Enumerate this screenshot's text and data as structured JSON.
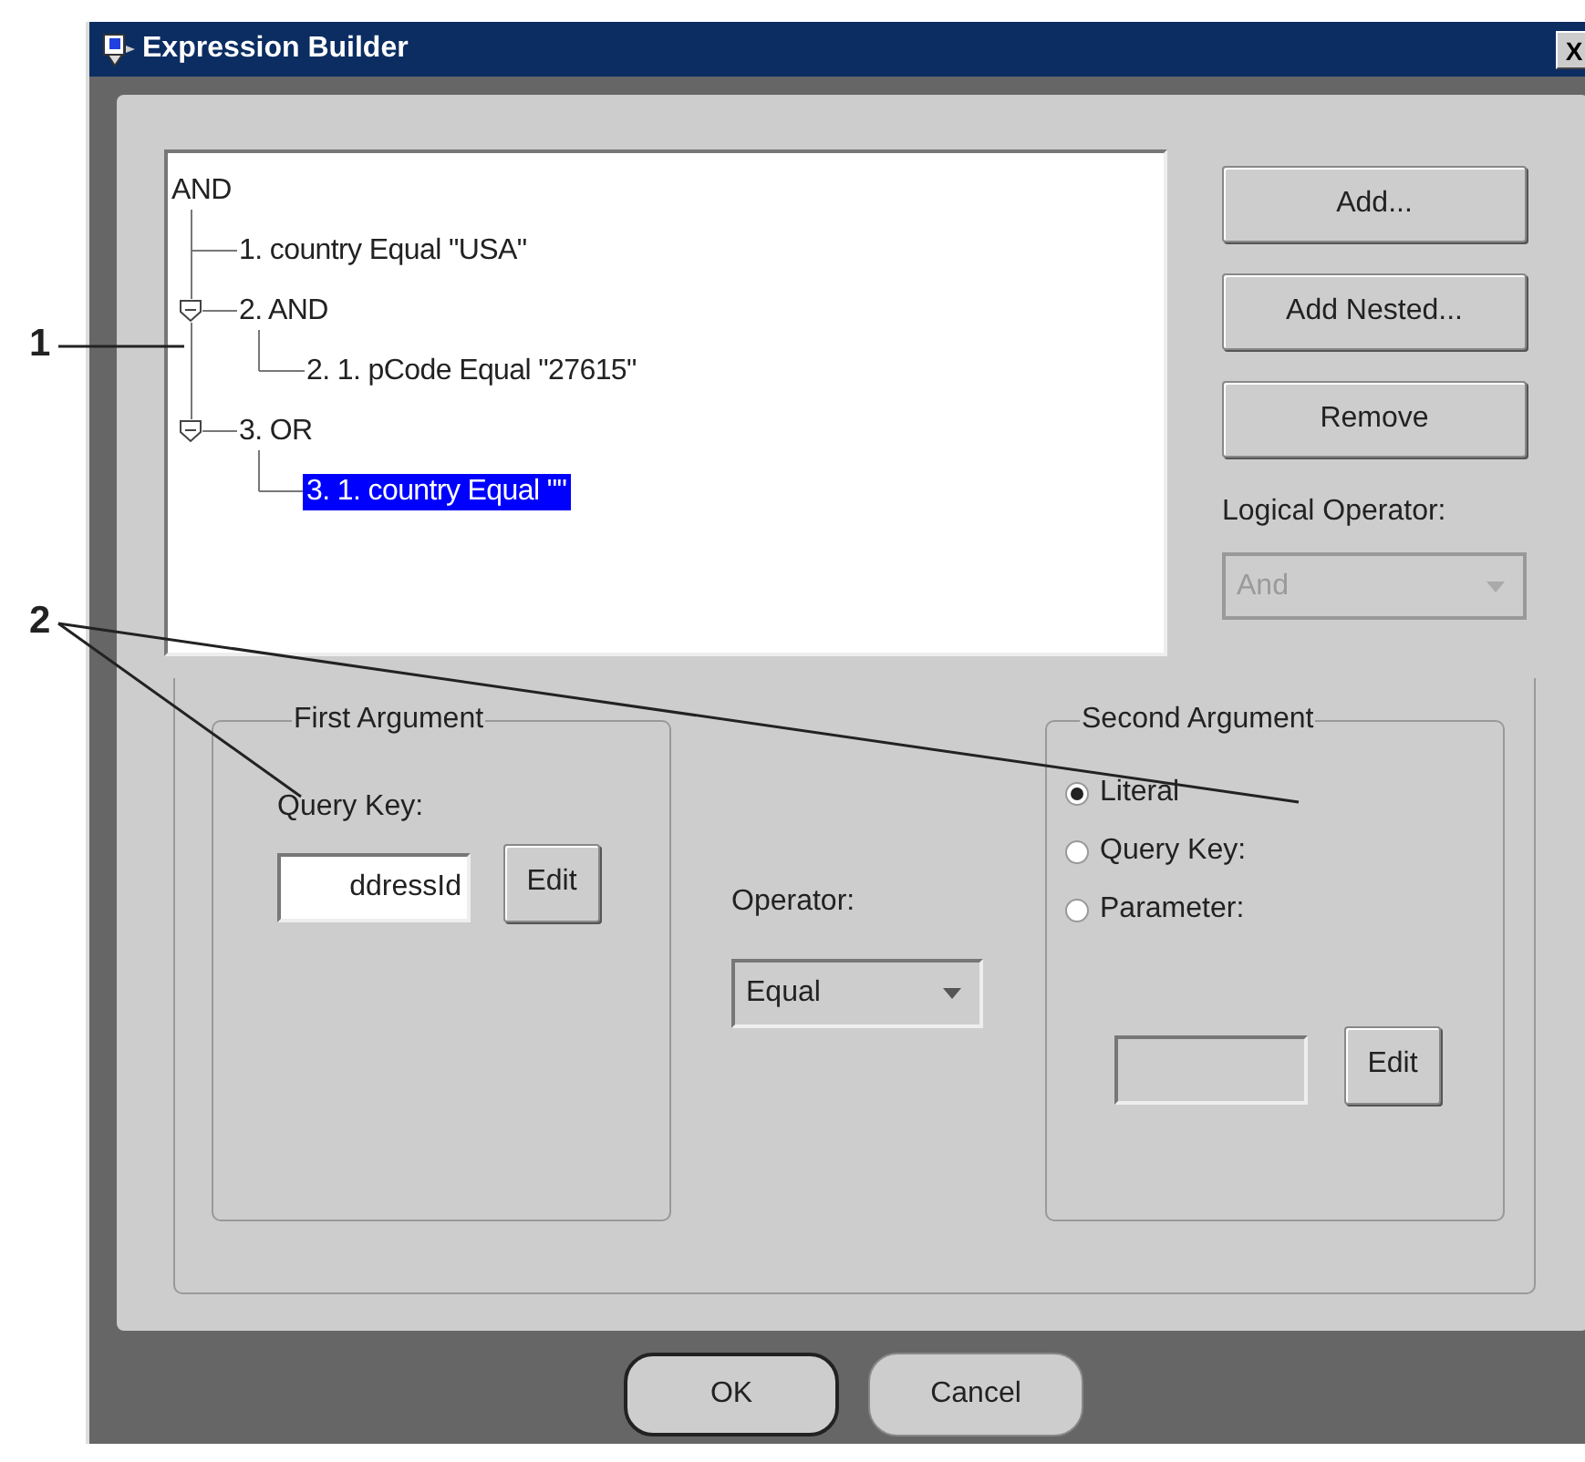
{
  "window": {
    "title": "Expression Builder",
    "close": "X"
  },
  "tree": {
    "label": "AND",
    "selected": false,
    "children": [
      {
        "label": "1. country Equal \"USA\"",
        "selected": false
      },
      {
        "label": "2. AND",
        "selected": false,
        "expanded": true,
        "children": [
          {
            "label": "2. 1. pCode Equal \"27615\"",
            "selected": false
          }
        ]
      },
      {
        "label": "3. OR",
        "selected": false,
        "expanded": true,
        "children": [
          {
            "label": "3. 1. country Equal \"\"",
            "selected": true
          }
        ]
      }
    ]
  },
  "buttons": [
    "Add...",
    "Add Nested...",
    "Remove"
  ],
  "logical_operator": {
    "label": "Logical Operator:",
    "value": "And",
    "disabled": true
  },
  "first_argument": {
    "title": "First Argument",
    "label": "Query Key:",
    "value": "ddressId",
    "edit": "Edit"
  },
  "operator": {
    "label": "Operator:",
    "value": "Equal",
    "disabled": false
  },
  "second_argument": {
    "title": "Second Argument",
    "options": [
      {
        "label": "Literal",
        "selected": true
      },
      {
        "label": "Query Key:",
        "selected": false
      },
      {
        "label": "Parameter:",
        "selected": false
      }
    ],
    "edit": "Edit"
  },
  "footer": [
    {
      "label": "OK",
      "default": true
    },
    {
      "label": "Cancel",
      "default": false
    }
  ],
  "callouts": [
    "1",
    "2"
  ]
}
